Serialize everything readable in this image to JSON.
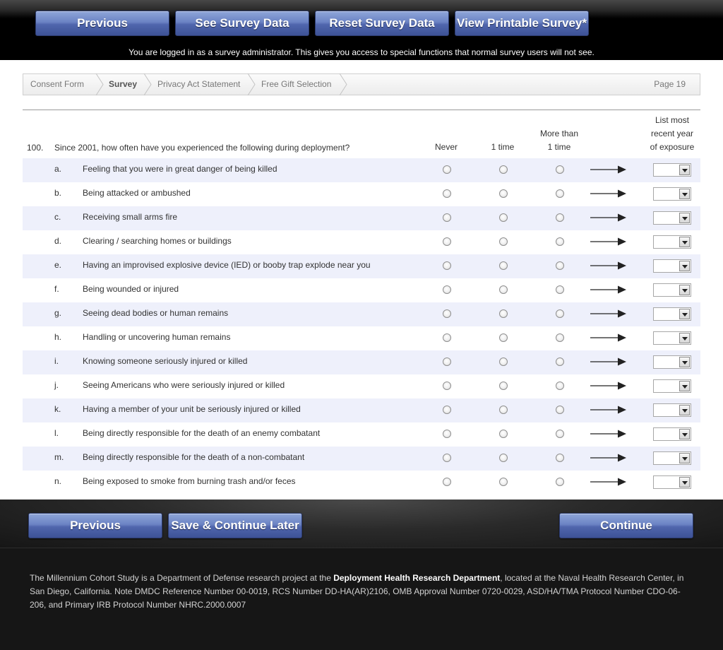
{
  "top_nav": {
    "previous_label": "Previous",
    "see_data_label": "See Survey Data",
    "reset_data_label": "Reset Survey Data",
    "printable_label": "View Printable Survey*"
  },
  "admin_notice": "You are logged in as a survey administrator. This gives you access to special functions that normal survey users will not see.",
  "breadcrumb": {
    "items": [
      {
        "label": "Consent Form",
        "active": false
      },
      {
        "label": "Survey",
        "active": true
      },
      {
        "label": "Privacy Act Statement",
        "active": false
      },
      {
        "label": "Free Gift Selection",
        "active": false
      }
    ],
    "page_label": "Page 19"
  },
  "question": {
    "number": "100.",
    "text": "Since 2001, how often have you experienced the following during deployment?",
    "columns": {
      "never": "Never",
      "one_time": "1 time",
      "more_than_line1": "More than",
      "more_than_line2": "1 time",
      "year_line1": "List most",
      "year_line2": "recent year",
      "year_line3": "of exposure"
    },
    "items": [
      {
        "letter": "a.",
        "text": "Feeling that you were in great danger of being killed"
      },
      {
        "letter": "b.",
        "text": "Being attacked or ambushed"
      },
      {
        "letter": "c.",
        "text": "Receiving small arms fire"
      },
      {
        "letter": "d.",
        "text": "Clearing / searching homes or buildings"
      },
      {
        "letter": "e.",
        "text": "Having an improvised explosive device (IED) or booby trap explode near you"
      },
      {
        "letter": "f.",
        "text": "Being wounded or injured"
      },
      {
        "letter": "g.",
        "text": "Seeing dead bodies or human remains"
      },
      {
        "letter": "h.",
        "text": "Handling or uncovering human remains"
      },
      {
        "letter": "i.",
        "text": "Knowing someone seriously injured or killed"
      },
      {
        "letter": "j.",
        "text": "Seeing Americans who were seriously injured or killed"
      },
      {
        "letter": "k.",
        "text": "Having a member of your unit be seriously injured or killed"
      },
      {
        "letter": "l.",
        "text": "Being directly responsible for the death of an enemy combatant"
      },
      {
        "letter": "m.",
        "text": "Being directly responsible for the death of a non-combatant"
      },
      {
        "letter": "n.",
        "text": "Being exposed to smoke from burning trash and/or feces"
      }
    ]
  },
  "bottom_nav": {
    "previous_label": "Previous",
    "save_label": "Save & Continue Later",
    "continue_label": "Continue"
  },
  "footer": {
    "text_before": "The Millennium Cohort Study is a Department of Defense research project at the ",
    "org_name": "Deployment Health Research Department",
    "text_after": ", located at the Naval Health Research Center, in San Diego, California. Note DMDC Reference Number 00-0019, RCS Number DD-HA(AR)2106, OMB Approval Number 0720-0029, ASD/HA/TMA Protocol Number CDO-06-206, and Primary IRB Protocol Number NHRC.2000.0007"
  },
  "colors": {
    "button_blue": "#5066ad",
    "row_shade": "#eef0fb",
    "page_background": "#161616"
  }
}
